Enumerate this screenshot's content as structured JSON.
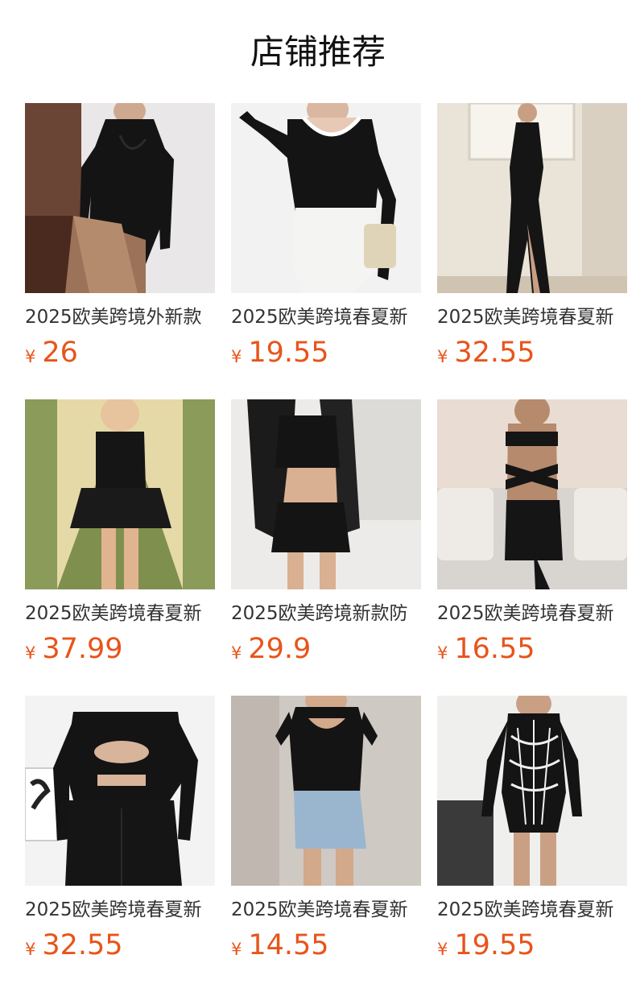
{
  "header": {
    "title": "店铺推荐"
  },
  "currency_symbol": "¥",
  "colors": {
    "price": "#e8541a",
    "title": "#111111",
    "name": "#333333"
  },
  "products": [
    {
      "name": "2025欧美跨境外新款",
      "price": "26",
      "image": "black-twist-top-brown-skirt-photo"
    },
    {
      "name": "2025欧美跨境春夏新",
      "price": "19.55",
      "image": "black-top-white-skirt-photo"
    },
    {
      "name": "2025欧美跨境春夏新",
      "price": "32.55",
      "image": "black-halter-slit-dress-photo"
    },
    {
      "name": "2025欧美跨境春夏新",
      "price": "37.99",
      "image": "black-mini-dress-hallway-photo"
    },
    {
      "name": "2025欧美跨境新款防",
      "price": "29.9",
      "image": "black-crop-top-mini-skirt-photo"
    },
    {
      "name": "2025欧美跨境春夏新",
      "price": "16.55",
      "image": "black-cutout-bandeau-set-photo"
    },
    {
      "name": "2025欧美跨境春夏新",
      "price": "32.55",
      "image": "black-cutout-top-pants-photo"
    },
    {
      "name": "2025欧美跨境春夏新",
      "price": "14.55",
      "image": "black-bodysuit-denim-shorts-photo"
    },
    {
      "name": "2025欧美跨境春夏新",
      "price": "19.55",
      "image": "black-web-print-bodysuit-photo"
    }
  ]
}
